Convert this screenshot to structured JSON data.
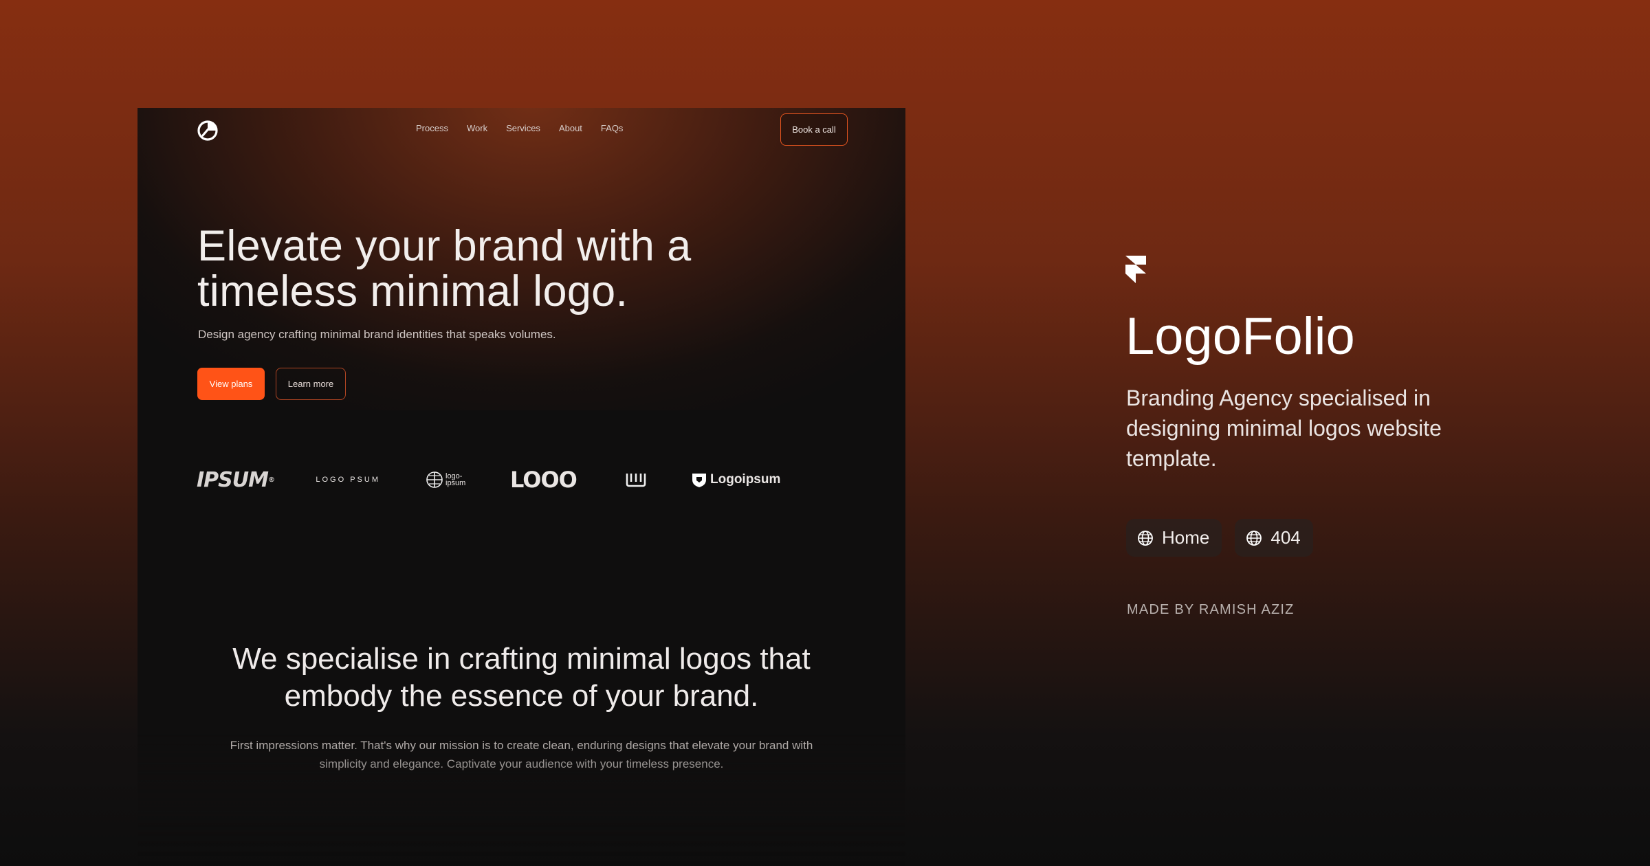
{
  "preview": {
    "nav": {
      "links": [
        "Process",
        "Work",
        "Services",
        "About",
        "FAQs"
      ],
      "cta": "Book a call"
    },
    "hero": {
      "title_line1": "Elevate your brand with a",
      "title_line2": "timeless minimal logo.",
      "subtitle": "Design agency crafting minimal brand identities that speaks volumes.",
      "primary_button": "View plans",
      "secondary_button": "Learn more"
    },
    "client_logos": {
      "ipsum": "IPSUM",
      "logopsum": "LOGO PSUM",
      "circle_top": "logo-",
      "circle_bottom": "ipsum",
      "loop": "LOOO",
      "logoipsum": "Logoipsum"
    },
    "section": {
      "title_line1": "We specialise in crafting minimal logos that",
      "title_line2": "embody the essence of your brand.",
      "text_line1": "First impressions matter. That's why our mission is to create clean, enduring designs that elevate your brand with",
      "text_line2": "simplicity and elegance. Captivate your audience with your timeless presence."
    }
  },
  "info": {
    "title": "LogoFolio",
    "description": "Branding Agency specialised in designing minimal logos website template.",
    "pages": [
      {
        "label": "Home",
        "icon": "globe-icon"
      },
      {
        "label": "404",
        "icon": "globe-icon"
      }
    ],
    "made_by": "MADE BY RAMISH AZIZ"
  },
  "colors": {
    "accent": "#ff5317",
    "background_top": "#862e11",
    "background_bottom": "#0d0d0d"
  }
}
